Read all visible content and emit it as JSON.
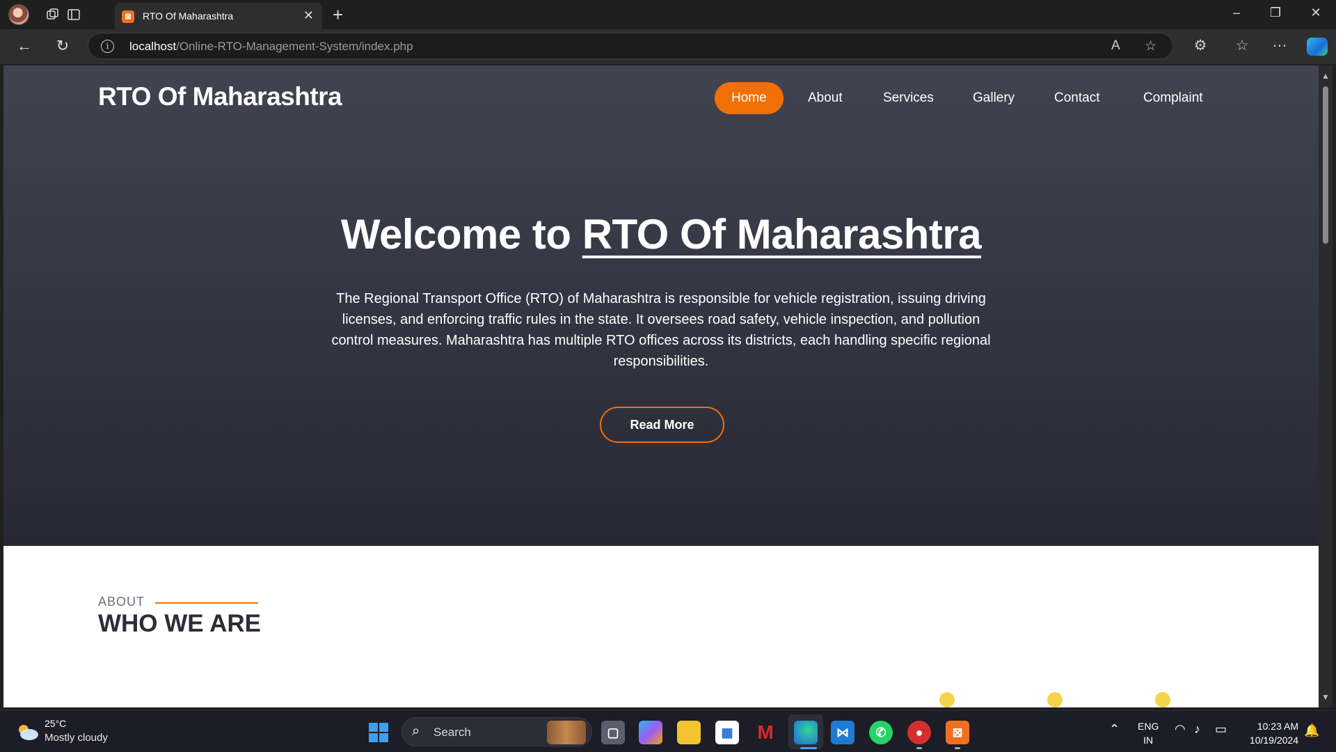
{
  "browser": {
    "tab_title": "RTO Of Maharashtra",
    "tab_favicon": "xampp",
    "url_host": "localhost",
    "url_path": "/Online-RTO-Management-System/index.php"
  },
  "site": {
    "brand": "RTO Of Maharashtra",
    "nav": [
      {
        "label": "Home",
        "active": true
      },
      {
        "label": "About",
        "active": false
      },
      {
        "label": "Services",
        "active": false
      },
      {
        "label": "Gallery",
        "active": false
      },
      {
        "label": "Contact",
        "active": false
      },
      {
        "label": "Complaint",
        "active": false
      }
    ],
    "hero": {
      "title_prefix": "Welcome to ",
      "title_highlight": "RTO Of Maharashtra",
      "text": "The Regional Transport Office (RTO) of Maharashtra is responsible for vehicle registration, issuing driving licenses, and enforcing traffic rules in the state. It oversees road safety, vehicle inspection, and pollution control measures. Maharashtra has multiple RTO offices across its districts, each handling specific regional responsibilities.",
      "button": "Read More"
    },
    "about": {
      "kicker": "ABOUT",
      "title": "WHO WE ARE"
    },
    "colors": {
      "accent": "#f26f08",
      "hero_top": "#414350",
      "hero_bottom": "#272833"
    }
  },
  "taskbar": {
    "weather_temp": "25°C",
    "weather_desc": "Mostly cloudy",
    "search_label": "Search",
    "lang_line1": "ENG",
    "lang_line2": "IN",
    "time": "10:23 AM",
    "date": "10/19/2024",
    "apps": [
      "task-view",
      "copilot",
      "file-explorer",
      "microsoft-store",
      "mcafee",
      "edge",
      "vscode",
      "whatsapp",
      "screen-recorder",
      "xampp"
    ]
  }
}
